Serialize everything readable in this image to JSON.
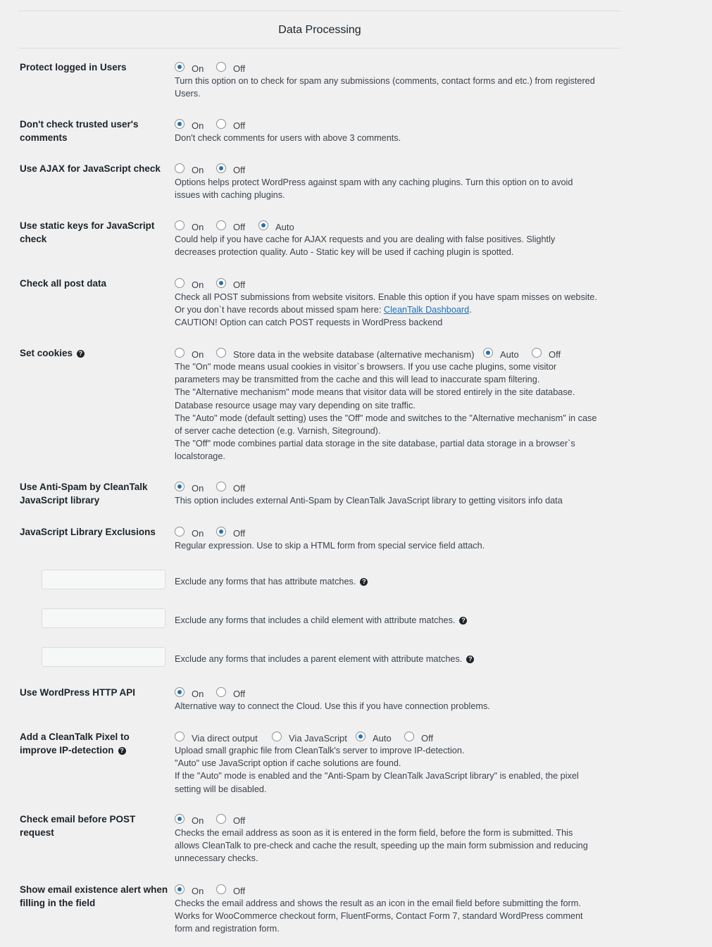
{
  "section_title": "Data Processing",
  "colors": {
    "accent": "#2271b1",
    "background": "#f0f0f1"
  },
  "settings": {
    "protect_logged": {
      "label": "Protect logged in Users",
      "on": "On",
      "off": "Off",
      "selected": "on",
      "desc": "Turn this option on to check for spam any submissions (comments, contact forms and etc.) from registered Users."
    },
    "trusted_comments": {
      "label": "Don't check trusted user's comments",
      "on": "On",
      "off": "Off",
      "selected": "on",
      "desc": "Don't check comments for users with above 3 comments."
    },
    "ajax_js": {
      "label": "Use AJAX for JavaScript check",
      "on": "On",
      "off": "Off",
      "selected": "off",
      "desc": "Options helps protect WordPress against spam with any caching plugins. Turn this option on to avoid issues with caching plugins."
    },
    "static_keys": {
      "label": "Use static keys for JavaScript check",
      "on": "On",
      "off": "Off",
      "auto": "Auto",
      "selected": "auto",
      "desc": "Could help if you have cache for AJAX requests and you are dealing with false positives. Slightly decreases protection quality. Auto - Static key will be used if caching plugin is spotted."
    },
    "post_data": {
      "label": "Check all post data",
      "on": "On",
      "off": "Off",
      "selected": "off",
      "desc_1": "Check all POST submissions from website visitors. Enable this option if you have spam misses on website. Or you don`t have records about missed spam here: ",
      "link": "CleanTalk Dashboard",
      "desc_2": ".",
      "desc_3": "CAUTION! Option can catch POST requests in WordPress backend"
    },
    "cookies": {
      "label": "Set cookies",
      "on": "On",
      "alt": "Store data in the website database (alternative mechanism)",
      "auto": "Auto",
      "off": "Off",
      "selected": "auto",
      "desc_1": "The \"On\" mode means usual cookies in visitor`s browsers. If you use cache plugins, some visitor parameters may be transmitted from the cache and this will lead to inaccurate spam filtering.",
      "desc_2": "The \"Alternative mechanism\" mode means that visitor data will be stored entirely in the site database. Database resource usage may vary depending on site traffic.",
      "desc_3": "The \"Auto\" mode (default setting) uses the \"Off\" mode and switches to the \"Alternative mechanism\" in case of server cache detection (e.g. Varnish, Siteground).",
      "desc_4": "The \"Off\" mode combines partial data storage in the site database, partial data storage in a browser`s localstorage."
    },
    "js_library": {
      "label": "Use Anti-Spam by CleanTalk JavaScript library",
      "on": "On",
      "off": "Off",
      "selected": "on",
      "desc": "This option includes external Anti-Spam by CleanTalk JavaScript library to getting visitors info data"
    },
    "js_exclusions": {
      "label": "JavaScript Library Exclusions",
      "on": "On",
      "off": "Off",
      "selected": "off",
      "desc": "Regular expression. Use to skip a HTML form from special service field attach.",
      "input_1": {
        "value": "",
        "text": "Exclude any forms that has attribute matches."
      },
      "input_2": {
        "value": "",
        "text": "Exclude any forms that includes a child element with attribute matches."
      },
      "input_3": {
        "value": "",
        "text": "Exclude any forms that includes a parent element with attribute matches."
      }
    },
    "http_api": {
      "label": "Use WordPress HTTP API",
      "on": "On",
      "off": "Off",
      "selected": "on",
      "desc": "Alternative way to connect the Cloud. Use this if you have connection problems."
    },
    "pixel": {
      "label": "Add a CleanTalk Pixel to improve IP-detection",
      "direct": "Via direct output",
      "js": "Via JavaScript",
      "auto": "Auto",
      "off": "Off",
      "selected": "auto",
      "desc_1": "Upload small graphic file from CleanTalk's server to improve IP-detection.",
      "desc_2": "\"Auto\" use JavaScript option if cache solutions are found.",
      "desc_3": "If the \"Auto\" mode is enabled and the \"Anti-Spam by CleanTalk JavaScript library\" is enabled, the pixel setting will be disabled."
    },
    "email_check": {
      "label": "Check email before POST request",
      "on": "On",
      "off": "Off",
      "selected": "on",
      "desc": "Checks the email address as soon as it is entered in the form field, before the form is submitted. This allows CleanTalk to pre-check and cache the result, speeding up the main form submission and reducing unnecessary checks."
    },
    "email_alert": {
      "label": "Show email existence alert when filling in the field",
      "on": "On",
      "off": "Off",
      "selected": "on",
      "desc": "Checks the email address and shows the result as an icon in the email field before submitting the form. Works for WooCommerce checkout form, FluentForms, Contact Form 7, standard WordPress comment form and registration form."
    }
  }
}
